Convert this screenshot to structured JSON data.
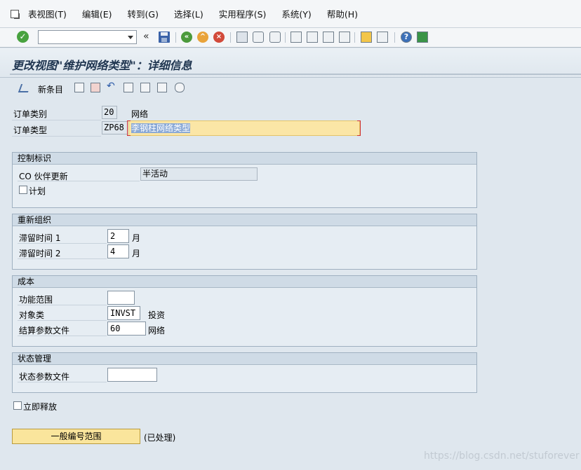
{
  "menu": [
    "表视图(T)",
    "编辑(E)",
    "转到(G)",
    "选择(L)",
    "实用程序(S)",
    "系统(Y)",
    "帮助(H)"
  ],
  "toolbar": {
    "command_value": ""
  },
  "title": "更改视图\"维护网络类型\"：详细信息",
  "apptoolbar": {
    "new_entries": "新条目"
  },
  "header": {
    "order_category_label": "订单类别",
    "order_category_value": "20",
    "order_category_text": "网络",
    "order_type_label": "订单类型",
    "order_type_value": "ZP68",
    "order_type_desc": "李钢柱网络类型"
  },
  "control": {
    "title": "控制标识",
    "co_partner_label": "CO 伙伴更新",
    "co_partner_value": "半活动",
    "planning_label": "计划"
  },
  "reorg": {
    "title": "重新组织",
    "residence1_label": "滞留时间 1",
    "residence1_value": "2",
    "residence1_unit": "月",
    "residence2_label": "滞留时间 2",
    "residence2_value": "4",
    "residence2_unit": "月"
  },
  "costs": {
    "title": "成本",
    "functional_area_label": "功能范围",
    "functional_area_value": "",
    "object_class_label": "对象类",
    "object_class_value": "INVST",
    "object_class_text": "投资",
    "settlement_label": "结算参数文件",
    "settlement_value": "60",
    "settlement_text": "网络"
  },
  "status": {
    "title": "状态管理",
    "profile_label": "状态参数文件",
    "profile_value": ""
  },
  "release_label": "立即释放",
  "number_range_button": "一般编号范围",
  "number_range_status": "(已处理)",
  "watermark": "https://blog.csdn.net/stuforever"
}
